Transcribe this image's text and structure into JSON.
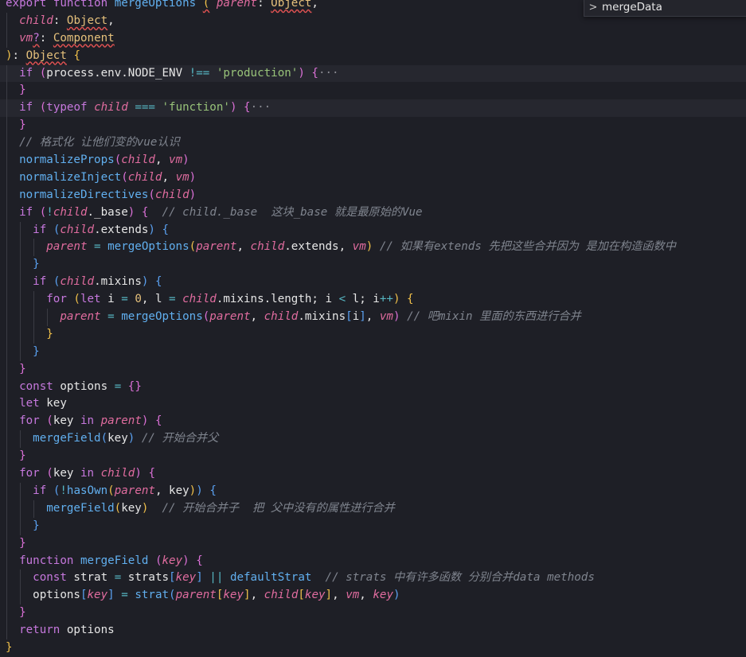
{
  "breadcrumb": {
    "chevron": ">",
    "label": "mergeData"
  },
  "lines": [
    {
      "indent": 0,
      "tokens": [
        {
          "c": "kw",
          "t": "export"
        },
        {
          "c": "plain",
          "t": " "
        },
        {
          "c": "kw",
          "t": "function"
        },
        {
          "c": "plain",
          "t": " "
        },
        {
          "c": "fn",
          "t": "mergeOptions"
        },
        {
          "c": "plain",
          "t": " "
        },
        {
          "c": "br1 squiggle",
          "t": "("
        },
        {
          "c": "plain",
          "t": " "
        },
        {
          "c": "param",
          "t": "parent"
        },
        {
          "c": "plain",
          "t": ": "
        },
        {
          "c": "type squiggle",
          "t": "Object"
        },
        {
          "c": "plain",
          "t": ","
        }
      ]
    },
    {
      "indent": 1,
      "tokens": [
        {
          "c": "param",
          "t": "child"
        },
        {
          "c": "plain",
          "t": ": "
        },
        {
          "c": "type squiggle",
          "t": "Object"
        },
        {
          "c": "plain",
          "t": ","
        }
      ]
    },
    {
      "indent": 1,
      "tokens": [
        {
          "c": "param",
          "t": "vm"
        },
        {
          "c": "kw squiggle",
          "t": "?"
        },
        {
          "c": "plain",
          "t": ": "
        },
        {
          "c": "type squiggle",
          "t": "Component"
        }
      ]
    },
    {
      "indent": 0,
      "tokens": [
        {
          "c": "br1",
          "t": ")"
        },
        {
          "c": "plain",
          "t": ": "
        },
        {
          "c": "type squiggle",
          "t": "Object"
        },
        {
          "c": "plain",
          "t": " "
        },
        {
          "c": "br1",
          "t": "{"
        }
      ]
    },
    {
      "indent": 1,
      "current": true,
      "tokens": [
        {
          "c": "kw",
          "t": "if"
        },
        {
          "c": "plain",
          "t": " "
        },
        {
          "c": "br2",
          "t": "("
        },
        {
          "c": "plain",
          "t": "process.env.NODE_ENV "
        },
        {
          "c": "cyan",
          "t": "!=="
        },
        {
          "c": "plain",
          "t": " "
        },
        {
          "c": "str",
          "t": "'production'"
        },
        {
          "c": "br2",
          "t": ")"
        },
        {
          "c": "plain",
          "t": " "
        },
        {
          "c": "br2",
          "t": "{"
        },
        {
          "c": "fold",
          "t": "···"
        }
      ]
    },
    {
      "indent": 1,
      "tokens": [
        {
          "c": "br2",
          "t": "}"
        }
      ]
    },
    {
      "indent": 1,
      "current": true,
      "tokens": [
        {
          "c": "kw",
          "t": "if"
        },
        {
          "c": "plain",
          "t": " "
        },
        {
          "c": "br2",
          "t": "("
        },
        {
          "c": "kw",
          "t": "typeof"
        },
        {
          "c": "plain",
          "t": " "
        },
        {
          "c": "param",
          "t": "child"
        },
        {
          "c": "plain",
          "t": " "
        },
        {
          "c": "cyan",
          "t": "==="
        },
        {
          "c": "plain",
          "t": " "
        },
        {
          "c": "str",
          "t": "'function'"
        },
        {
          "c": "br2",
          "t": ")"
        },
        {
          "c": "plain",
          "t": " "
        },
        {
          "c": "br2",
          "t": "{"
        },
        {
          "c": "fold",
          "t": "···"
        }
      ]
    },
    {
      "indent": 1,
      "tokens": [
        {
          "c": "br2",
          "t": "}"
        }
      ]
    },
    {
      "indent": 1,
      "tokens": [
        {
          "c": "cmt",
          "t": "// 格式化 让他们变的vue认识"
        }
      ]
    },
    {
      "indent": 1,
      "tokens": [
        {
          "c": "fn",
          "t": "normalizeProps"
        },
        {
          "c": "br2",
          "t": "("
        },
        {
          "c": "param",
          "t": "child"
        },
        {
          "c": "plain",
          "t": ", "
        },
        {
          "c": "param",
          "t": "vm"
        },
        {
          "c": "br2",
          "t": ")"
        }
      ]
    },
    {
      "indent": 1,
      "tokens": [
        {
          "c": "fn",
          "t": "normalizeInject"
        },
        {
          "c": "br2",
          "t": "("
        },
        {
          "c": "param",
          "t": "child"
        },
        {
          "c": "plain",
          "t": ", "
        },
        {
          "c": "param",
          "t": "vm"
        },
        {
          "c": "br2",
          "t": ")"
        }
      ]
    },
    {
      "indent": 1,
      "tokens": [
        {
          "c": "fn",
          "t": "normalizeDirectives"
        },
        {
          "c": "br2",
          "t": "("
        },
        {
          "c": "param",
          "t": "child"
        },
        {
          "c": "br2",
          "t": ")"
        }
      ]
    },
    {
      "indent": 1,
      "tokens": [
        {
          "c": "kw",
          "t": "if"
        },
        {
          "c": "plain",
          "t": " "
        },
        {
          "c": "br2",
          "t": "("
        },
        {
          "c": "cyan",
          "t": "!"
        },
        {
          "c": "param",
          "t": "child"
        },
        {
          "c": "plain",
          "t": "._base"
        },
        {
          "c": "br2",
          "t": ")"
        },
        {
          "c": "plain",
          "t": " "
        },
        {
          "c": "br2",
          "t": "{"
        },
        {
          "c": "plain",
          "t": "  "
        },
        {
          "c": "cmt",
          "t": "// child._base  这块_base 就是最原始的Vue"
        }
      ]
    },
    {
      "indent": 2,
      "tokens": [
        {
          "c": "kw",
          "t": "if"
        },
        {
          "c": "plain",
          "t": " "
        },
        {
          "c": "br3",
          "t": "("
        },
        {
          "c": "param",
          "t": "child"
        },
        {
          "c": "plain",
          "t": ".extends"
        },
        {
          "c": "br3",
          "t": ")"
        },
        {
          "c": "plain",
          "t": " "
        },
        {
          "c": "br3",
          "t": "{"
        }
      ]
    },
    {
      "indent": 3,
      "tokens": [
        {
          "c": "param",
          "t": "parent"
        },
        {
          "c": "plain",
          "t": " "
        },
        {
          "c": "cyan",
          "t": "="
        },
        {
          "c": "plain",
          "t": " "
        },
        {
          "c": "fn",
          "t": "mergeOptions"
        },
        {
          "c": "br1",
          "t": "("
        },
        {
          "c": "param",
          "t": "parent"
        },
        {
          "c": "plain",
          "t": ", "
        },
        {
          "c": "param",
          "t": "child"
        },
        {
          "c": "plain",
          "t": ".extends, "
        },
        {
          "c": "param",
          "t": "vm"
        },
        {
          "c": "br1",
          "t": ")"
        },
        {
          "c": "plain",
          "t": " "
        },
        {
          "c": "cmt",
          "t": "// 如果有extends 先把这些合并因为 是加在构造函数中"
        }
      ]
    },
    {
      "indent": 2,
      "tokens": [
        {
          "c": "br3",
          "t": "}"
        }
      ]
    },
    {
      "indent": 2,
      "tokens": [
        {
          "c": "kw",
          "t": "if"
        },
        {
          "c": "plain",
          "t": " "
        },
        {
          "c": "br3",
          "t": "("
        },
        {
          "c": "param",
          "t": "child"
        },
        {
          "c": "plain",
          "t": ".mixins"
        },
        {
          "c": "br3",
          "t": ")"
        },
        {
          "c": "plain",
          "t": " "
        },
        {
          "c": "br3",
          "t": "{"
        }
      ]
    },
    {
      "indent": 3,
      "tokens": [
        {
          "c": "kw",
          "t": "for"
        },
        {
          "c": "plain",
          "t": " "
        },
        {
          "c": "br1",
          "t": "("
        },
        {
          "c": "kw",
          "t": "let"
        },
        {
          "c": "plain",
          "t": " i "
        },
        {
          "c": "cyan",
          "t": "="
        },
        {
          "c": "plain",
          "t": " "
        },
        {
          "c": "type",
          "t": "0"
        },
        {
          "c": "plain",
          "t": ", l "
        },
        {
          "c": "cyan",
          "t": "="
        },
        {
          "c": "plain",
          "t": " "
        },
        {
          "c": "param",
          "t": "child"
        },
        {
          "c": "plain",
          "t": ".mixins.length; i "
        },
        {
          "c": "cyan",
          "t": "<"
        },
        {
          "c": "plain",
          "t": " l; i"
        },
        {
          "c": "cyan",
          "t": "++"
        },
        {
          "c": "br1",
          "t": ")"
        },
        {
          "c": "plain",
          "t": " "
        },
        {
          "c": "br1",
          "t": "{"
        }
      ]
    },
    {
      "indent": 4,
      "tokens": [
        {
          "c": "param",
          "t": "parent"
        },
        {
          "c": "plain",
          "t": " "
        },
        {
          "c": "cyan",
          "t": "="
        },
        {
          "c": "plain",
          "t": " "
        },
        {
          "c": "fn",
          "t": "mergeOptions"
        },
        {
          "c": "br2",
          "t": "("
        },
        {
          "c": "param",
          "t": "parent"
        },
        {
          "c": "plain",
          "t": ", "
        },
        {
          "c": "param",
          "t": "child"
        },
        {
          "c": "plain",
          "t": ".mixins"
        },
        {
          "c": "br3",
          "t": "["
        },
        {
          "c": "plain",
          "t": "i"
        },
        {
          "c": "br3",
          "t": "]"
        },
        {
          "c": "plain",
          "t": ", "
        },
        {
          "c": "param",
          "t": "vm"
        },
        {
          "c": "br2",
          "t": ")"
        },
        {
          "c": "plain",
          "t": " "
        },
        {
          "c": "cmt",
          "t": "// 吧mixin 里面的东西进行合并"
        }
      ]
    },
    {
      "indent": 3,
      "tokens": [
        {
          "c": "br1",
          "t": "}"
        }
      ]
    },
    {
      "indent": 2,
      "tokens": [
        {
          "c": "br3",
          "t": "}"
        }
      ]
    },
    {
      "indent": 1,
      "tokens": [
        {
          "c": "br2",
          "t": "}"
        }
      ]
    },
    {
      "indent": 1,
      "tokens": [
        {
          "c": "kw",
          "t": "const"
        },
        {
          "c": "plain",
          "t": " options "
        },
        {
          "c": "cyan",
          "t": "="
        },
        {
          "c": "plain",
          "t": " "
        },
        {
          "c": "br2",
          "t": "{}"
        }
      ]
    },
    {
      "indent": 1,
      "tokens": [
        {
          "c": "kw",
          "t": "let"
        },
        {
          "c": "plain",
          "t": " key"
        }
      ]
    },
    {
      "indent": 1,
      "tokens": [
        {
          "c": "kw",
          "t": "for"
        },
        {
          "c": "plain",
          "t": " "
        },
        {
          "c": "br2",
          "t": "("
        },
        {
          "c": "plain",
          "t": "key "
        },
        {
          "c": "kw",
          "t": "in"
        },
        {
          "c": "plain",
          "t": " "
        },
        {
          "c": "param",
          "t": "parent"
        },
        {
          "c": "br2",
          "t": ")"
        },
        {
          "c": "plain",
          "t": " "
        },
        {
          "c": "br2",
          "t": "{"
        }
      ]
    },
    {
      "indent": 2,
      "tokens": [
        {
          "c": "fn",
          "t": "mergeField"
        },
        {
          "c": "br3",
          "t": "("
        },
        {
          "c": "plain",
          "t": "key"
        },
        {
          "c": "br3",
          "t": ")"
        },
        {
          "c": "plain",
          "t": " "
        },
        {
          "c": "cmt",
          "t": "// 开始合并父"
        }
      ]
    },
    {
      "indent": 1,
      "tokens": [
        {
          "c": "br2",
          "t": "}"
        }
      ]
    },
    {
      "indent": 1,
      "tokens": [
        {
          "c": "kw",
          "t": "for"
        },
        {
          "c": "plain",
          "t": " "
        },
        {
          "c": "br2",
          "t": "("
        },
        {
          "c": "plain",
          "t": "key "
        },
        {
          "c": "kw",
          "t": "in"
        },
        {
          "c": "plain",
          "t": " "
        },
        {
          "c": "param",
          "t": "child"
        },
        {
          "c": "br2",
          "t": ")"
        },
        {
          "c": "plain",
          "t": " "
        },
        {
          "c": "br2",
          "t": "{"
        }
      ]
    },
    {
      "indent": 2,
      "tokens": [
        {
          "c": "kw",
          "t": "if"
        },
        {
          "c": "plain",
          "t": " "
        },
        {
          "c": "br3",
          "t": "("
        },
        {
          "c": "cyan",
          "t": "!"
        },
        {
          "c": "fn",
          "t": "hasOwn"
        },
        {
          "c": "br1",
          "t": "("
        },
        {
          "c": "param",
          "t": "parent"
        },
        {
          "c": "plain",
          "t": ", key"
        },
        {
          "c": "br1",
          "t": ")"
        },
        {
          "c": "br3",
          "t": ")"
        },
        {
          "c": "plain",
          "t": " "
        },
        {
          "c": "br3",
          "t": "{"
        }
      ]
    },
    {
      "indent": 3,
      "tokens": [
        {
          "c": "fn",
          "t": "mergeField"
        },
        {
          "c": "br1",
          "t": "("
        },
        {
          "c": "plain",
          "t": "key"
        },
        {
          "c": "br1",
          "t": ")"
        },
        {
          "c": "plain",
          "t": "  "
        },
        {
          "c": "cmt",
          "t": "// 开始合并子  把 父中没有的属性进行合并"
        }
      ]
    },
    {
      "indent": 2,
      "tokens": [
        {
          "c": "br3",
          "t": "}"
        }
      ]
    },
    {
      "indent": 1,
      "tokens": [
        {
          "c": "br2",
          "t": "}"
        }
      ]
    },
    {
      "indent": 1,
      "tokens": [
        {
          "c": "kw",
          "t": "function"
        },
        {
          "c": "plain",
          "t": " "
        },
        {
          "c": "fn",
          "t": "mergeField"
        },
        {
          "c": "plain",
          "t": " "
        },
        {
          "c": "br2",
          "t": "("
        },
        {
          "c": "param",
          "t": "key"
        },
        {
          "c": "br2",
          "t": ")"
        },
        {
          "c": "plain",
          "t": " "
        },
        {
          "c": "br2",
          "t": "{"
        }
      ]
    },
    {
      "indent": 2,
      "tokens": [
        {
          "c": "kw",
          "t": "const"
        },
        {
          "c": "plain",
          "t": " strat "
        },
        {
          "c": "cyan",
          "t": "="
        },
        {
          "c": "plain",
          "t": " strats"
        },
        {
          "c": "br3",
          "t": "["
        },
        {
          "c": "param",
          "t": "key"
        },
        {
          "c": "br3",
          "t": "]"
        },
        {
          "c": "plain",
          "t": " "
        },
        {
          "c": "cyan",
          "t": "||"
        },
        {
          "c": "plain",
          "t": " "
        },
        {
          "c": "fn",
          "t": "defaultStrat"
        },
        {
          "c": "plain",
          "t": "  "
        },
        {
          "c": "cmt",
          "t": "// strats 中有许多函数 分别合并data methods"
        }
      ]
    },
    {
      "indent": 2,
      "tokens": [
        {
          "c": "plain",
          "t": "options"
        },
        {
          "c": "br3",
          "t": "["
        },
        {
          "c": "param",
          "t": "key"
        },
        {
          "c": "br3",
          "t": "]"
        },
        {
          "c": "plain",
          "t": " "
        },
        {
          "c": "cyan",
          "t": "="
        },
        {
          "c": "plain",
          "t": " "
        },
        {
          "c": "fn",
          "t": "strat"
        },
        {
          "c": "br3",
          "t": "("
        },
        {
          "c": "param",
          "t": "parent"
        },
        {
          "c": "br1",
          "t": "["
        },
        {
          "c": "param",
          "t": "key"
        },
        {
          "c": "br1",
          "t": "]"
        },
        {
          "c": "plain",
          "t": ", "
        },
        {
          "c": "param",
          "t": "child"
        },
        {
          "c": "br1",
          "t": "["
        },
        {
          "c": "param",
          "t": "key"
        },
        {
          "c": "br1",
          "t": "]"
        },
        {
          "c": "plain",
          "t": ", "
        },
        {
          "c": "param",
          "t": "vm"
        },
        {
          "c": "plain",
          "t": ", "
        },
        {
          "c": "param",
          "t": "key"
        },
        {
          "c": "br3",
          "t": ")"
        }
      ]
    },
    {
      "indent": 1,
      "tokens": [
        {
          "c": "br2",
          "t": "}"
        }
      ]
    },
    {
      "indent": 1,
      "tokens": [
        {
          "c": "kw",
          "t": "return"
        },
        {
          "c": "plain",
          "t": " options"
        }
      ]
    },
    {
      "indent": 0,
      "tokens": [
        {
          "c": "br1",
          "t": "}"
        }
      ]
    }
  ]
}
